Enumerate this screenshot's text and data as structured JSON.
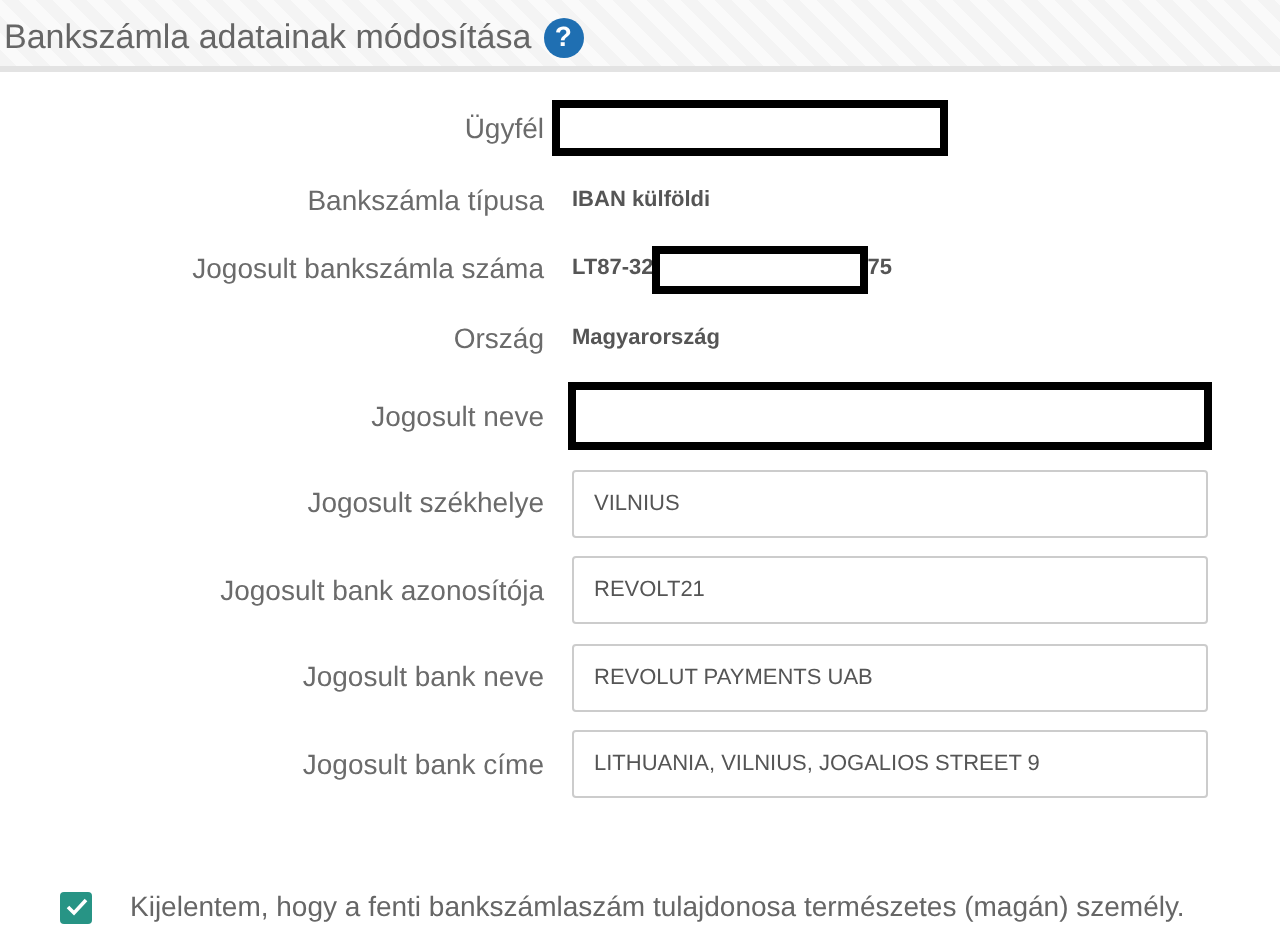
{
  "header": {
    "title": "Bankszámla adatainak módosítása",
    "help_icon": "?"
  },
  "fields": [
    {
      "kind": "redacted",
      "label": "Ügyfél"
    },
    {
      "kind": "static",
      "label": "Bankszámla típusa",
      "value": "IBAN külföldi"
    },
    {
      "kind": "partial",
      "label": "Jogosult bankszámla száma",
      "value_start": "LT87-32",
      "value_end": "75"
    },
    {
      "kind": "static",
      "label": "Ország",
      "value": "Magyarország"
    },
    {
      "kind": "redacted-input",
      "label": "Jogosult neve"
    },
    {
      "kind": "input",
      "label": "Jogosult székhelye",
      "value": "VILNIUS"
    },
    {
      "kind": "input",
      "label": "Jogosult bank azonosítója",
      "value": "REVOLT21"
    },
    {
      "kind": "input",
      "label": "Jogosult bank neve",
      "value": "REVOLUT PAYMENTS UAB"
    },
    {
      "kind": "input",
      "label": "Jogosult bank címe",
      "value": "LITHUANIA, VILNIUS, JOGALIOS STREET 9"
    }
  ],
  "declaration": {
    "checked": true,
    "text": "Kijelentem, hogy a fenti bankszámlaszám tulajdonosa természetes (magán) személy."
  }
}
